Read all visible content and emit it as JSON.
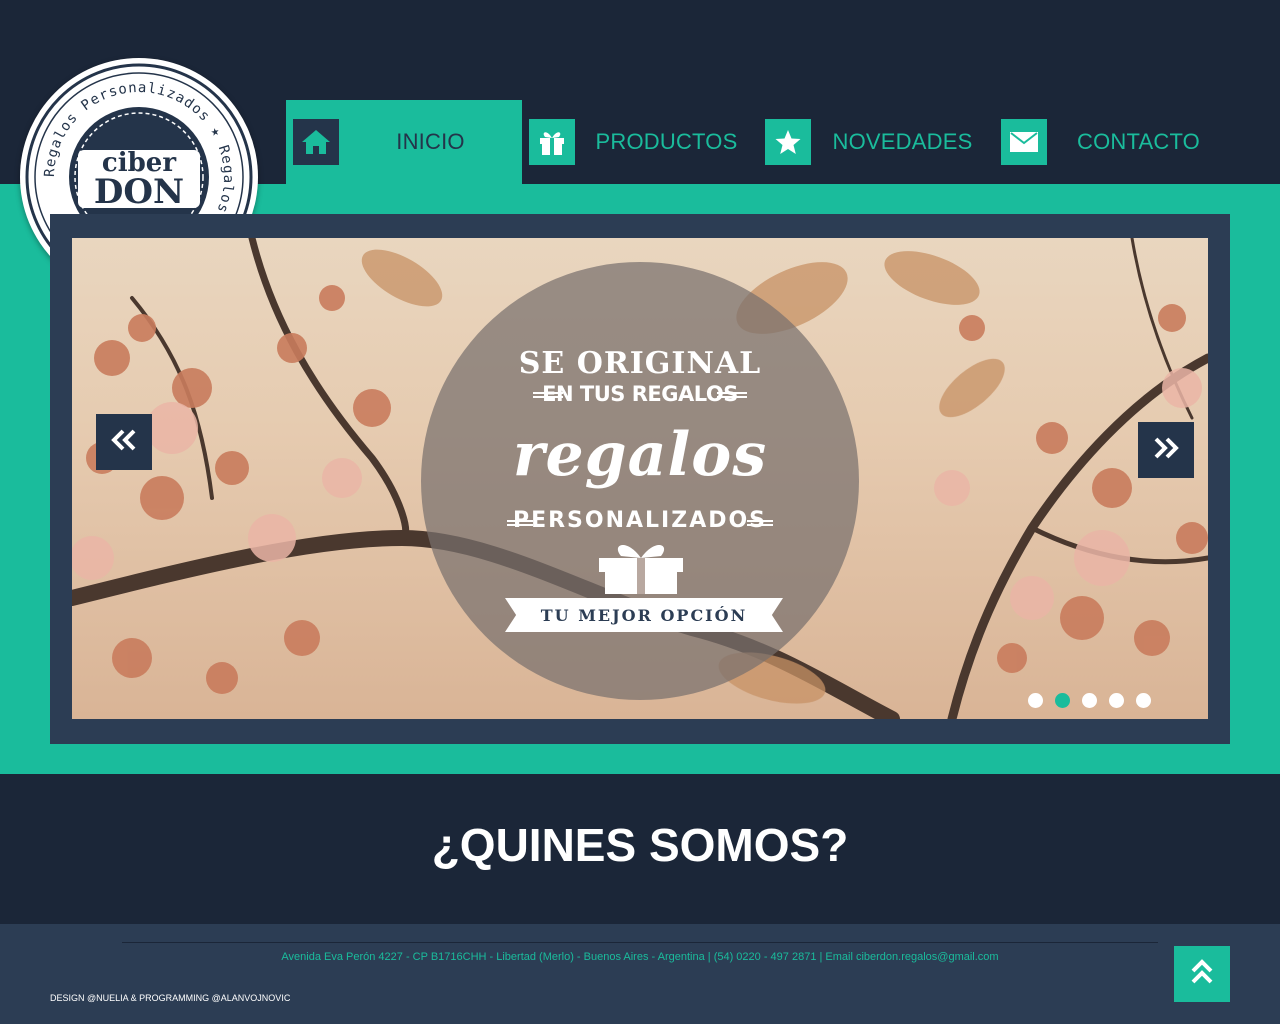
{
  "logo": {
    "top_word": "ciber",
    "bottom_word": "DON",
    "ring_text": "Regalos Personalizados"
  },
  "nav": {
    "items": [
      {
        "label": "INICIO",
        "icon": "home-icon",
        "active": true
      },
      {
        "label": "PRODUCTOS",
        "icon": "gift-icon",
        "active": false
      },
      {
        "label": "NOVEDADES",
        "icon": "star-icon",
        "active": false
      },
      {
        "label": "CONTACTO",
        "icon": "envelope-icon",
        "active": false
      }
    ]
  },
  "slider": {
    "line1": "SE ORIGINAL",
    "line2": "EN TUS REGALOS",
    "line3": "regalos",
    "line4": "PERSONALIZADOS",
    "ribbon": "TU MEJOR OPCIÓN",
    "prev_icon": "double-chevron-left-icon",
    "next_icon": "double-chevron-right-icon",
    "dots": 5,
    "active_dot": 2
  },
  "about": {
    "title": "¿QUINES SOMOS?"
  },
  "footer": {
    "address": "Avenida Eva Perón 4227 - CP B1716CHH - Libertad (Merlo) - Buenos Aires - Argentina | (54) 0220 - 497 2871 | Email ciberdon.regalos@gmail.com",
    "credits": "DESIGN @NUELIA & PROGRAMMING @ALANVOJNOVIC",
    "to_top_icon": "double-chevron-up-icon"
  },
  "colors": {
    "navy": "#1b2638",
    "slate": "#2c3d54",
    "teal": "#1abc9c",
    "white": "#ffffff"
  }
}
